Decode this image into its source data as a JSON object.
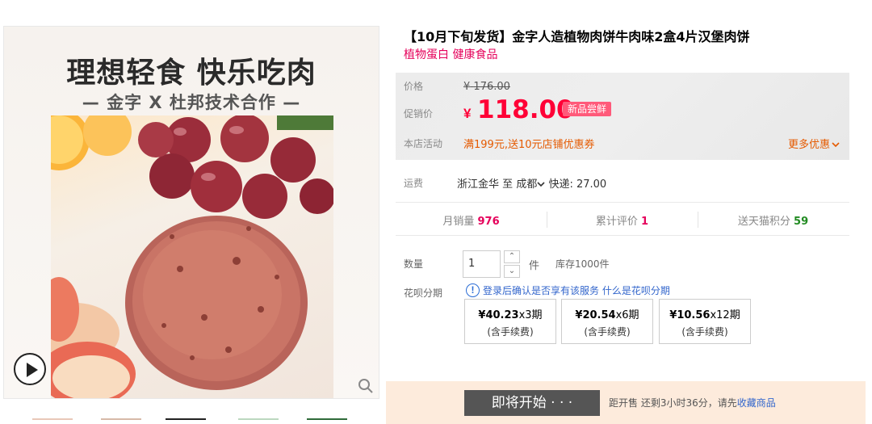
{
  "gallery": {
    "banner_title": "理想轻食 快乐吃肉",
    "banner_subtitle": "— 金字 X 杜邦技术合作 —",
    "icons": {
      "play": "play-circle-icon",
      "zoom": "magnifier-icon"
    }
  },
  "product": {
    "title": "【10月下旬发货】金字人造植物肉饼牛肉味2盒4片汉堡肉饼",
    "subtitle": "植物蛋白 健康食品"
  },
  "price": {
    "label_original": "价格",
    "original_currency": "¥",
    "original_value": "176.00",
    "label_promo": "促销价",
    "promo_currency": "¥",
    "promo_value": "118.00",
    "badge": "新品尝鲜",
    "label_activity": "本店活动",
    "activity": "满199元,送10元店铺优惠券",
    "more": "更多优惠",
    "colors": {
      "promo": "#ff0036",
      "activity": "#e55a00"
    }
  },
  "shipping": {
    "label": "运费",
    "from": "浙江金华",
    "to_prefix": "至",
    "to_city": "成都",
    "express": "快递: 27.00"
  },
  "stats": {
    "monthly_sales_label": "月销量",
    "monthly_sales": "976",
    "reviews_label": "累计评价",
    "reviews": "1",
    "points_label": "送天猫积分",
    "points": "59"
  },
  "quantity": {
    "label": "数量",
    "value": "1",
    "unit": "件",
    "stock": "库存1000件"
  },
  "huabei": {
    "label": "花呗分期",
    "notice": "登录后确认是否享有该服务",
    "link": "什么是花呗分期",
    "plans": [
      {
        "amount": "¥40.23",
        "period": "x3期",
        "fee": "(含手续费)"
      },
      {
        "amount": "¥20.54",
        "period": "x6期",
        "fee": "(含手续费)"
      },
      {
        "amount": "¥10.56",
        "period": "x12期",
        "fee": "(含手续费)"
      }
    ]
  },
  "buy": {
    "button": "即将开始 · · ·",
    "note_prefix": "距开售 还剩3小时36分，请先",
    "favorite": "收藏商品"
  }
}
